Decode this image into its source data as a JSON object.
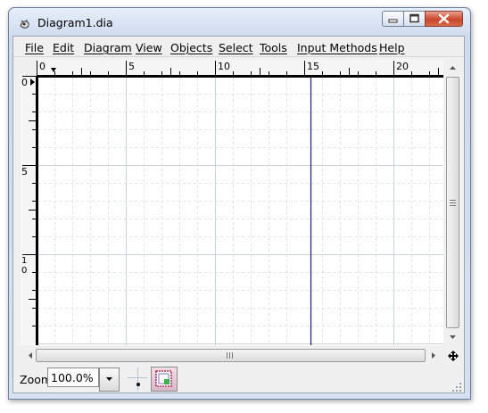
{
  "window": {
    "title": "Diagram1.dia"
  },
  "menu": {
    "items": [
      {
        "label": "File",
        "key": "file"
      },
      {
        "label": "Edit",
        "key": "edit"
      },
      {
        "label": "Diagram",
        "key": "diagram"
      },
      {
        "label": "View",
        "key": "view"
      },
      {
        "label": "Objects",
        "key": "objects"
      },
      {
        "label": "Select",
        "key": "select"
      },
      {
        "label": "Tools",
        "key": "tools"
      },
      {
        "label": "Input Methods",
        "key": "input-methods"
      },
      {
        "label": "Help",
        "key": "help"
      }
    ]
  },
  "ruler": {
    "top_labels": [
      "0",
      "5",
      "10",
      "15",
      "20"
    ],
    "left_labels": [
      "0",
      "5",
      "1\n0"
    ]
  },
  "status": {
    "zoom_label": "Zoom",
    "zoom_value": "100.0%"
  },
  "colors": {
    "grid_major": "#c8d6dc",
    "grid_minor": "#e2e2e2",
    "page_break": "#1a1a6e",
    "close_button": "#c9462c"
  },
  "icons": {
    "app": "dia-app-icon",
    "minimize": "minimize-icon",
    "maximize": "maximize-icon",
    "close": "close-icon",
    "snap_to_grid": "snap-to-grid-icon",
    "snap_to_objects": "snap-to-objects-icon",
    "move_canvas": "four-way-arrow-icon"
  }
}
